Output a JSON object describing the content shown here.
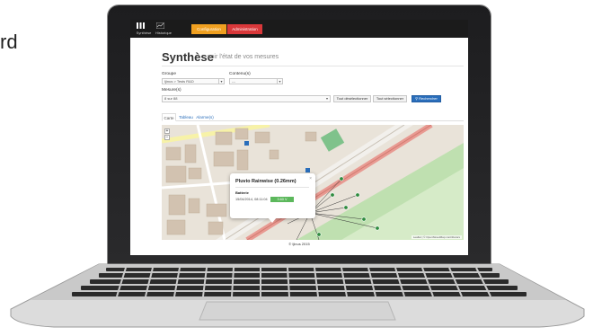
{
  "edge_text": "rd",
  "nav": {
    "items": [
      {
        "label": "Synthèse",
        "icon": "grid-icon"
      },
      {
        "label": "Historique",
        "icon": "chart-icon"
      }
    ],
    "buttons": [
      {
        "label": "Configuration",
        "color": "#f0a020"
      },
      {
        "label": "Administration",
        "color": "#d9383a"
      }
    ]
  },
  "header": {
    "title": "Synthèse",
    "subtitle": "voir l'état de vos mesures"
  },
  "filters": {
    "groupe_label": "Groupe",
    "groupe_value": "Ijinus > Tests R&D",
    "contenus_label": "Contenu(s)",
    "contenus_value": "---",
    "mesures_label": "Mesure(s)",
    "mesures_value": "8 sur 88",
    "deselect_all": "Tout désélectionner",
    "select_all": "Tout sélectionner",
    "search": "Rechercher"
  },
  "tabs": [
    {
      "label": "Carte",
      "active": true
    },
    {
      "label": "Tableau",
      "active": false
    },
    {
      "label": "Alarme(s)",
      "active": false
    }
  ],
  "map": {
    "zoom_in": "+",
    "zoom_out": "−",
    "attribution": "Leaflet | © OpenStreetMap contributors",
    "popup": {
      "title": "Pluvio Rainwise (0.26mm)",
      "close": "×",
      "label": "Batterie",
      "date": "15/04/2014, 08:11:04",
      "value": "3.60 V"
    }
  },
  "footer": "© Ijinus 2015",
  "colors": {
    "accent": "#2a6ebb",
    "ok": "#5cb85c",
    "navbar": "#1b1b1b"
  }
}
